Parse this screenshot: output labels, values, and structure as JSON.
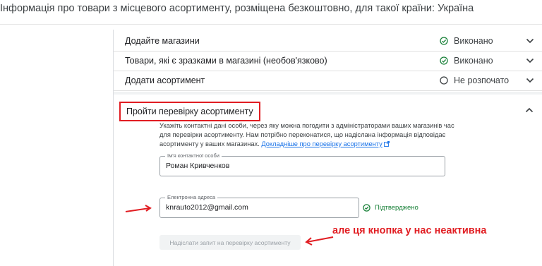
{
  "page": {
    "title": "Інформація про товари з місцевого асортименту, розміщена безкоштовно, для такої країни: Україна"
  },
  "steps": [
    {
      "label": "Додайте магазини",
      "status": "Виконано",
      "status_type": "done"
    },
    {
      "label": "Товари, які є зразками в магазині (необов'язково)",
      "status": "Виконано",
      "status_type": "done"
    },
    {
      "label": "Додати асортимент",
      "status": "Не розпочато",
      "status_type": "not_started"
    }
  ],
  "section": {
    "title": "Пройти перевірку асортименту",
    "description": "Укажіть контактні дані особи, через яку можна погодити з адміністраторами ваших магазинів час для перевірки асортименту. Нам потрібно переконатися, що надіслана інформація відповідає асортименту у ваших магазинах.",
    "link": "Докладніше про перевірку асортименту"
  },
  "form": {
    "name_label": "Ім'я контактної особи",
    "name_value": "Роман Кривченков",
    "email_label": "Електронна адреса",
    "email_value": "knrauto2012@gmail.com",
    "verified_text": "Підтверджено",
    "submit_label": "Надіслати запит на перевірку асортименту"
  },
  "annotation": {
    "text": "але ця кнопка у нас неактивна"
  },
  "colors": {
    "done": "#188038",
    "accent_link": "#1a73e8",
    "annotation_red": "#e11d22",
    "disabled_bg": "#f1f3f4"
  }
}
